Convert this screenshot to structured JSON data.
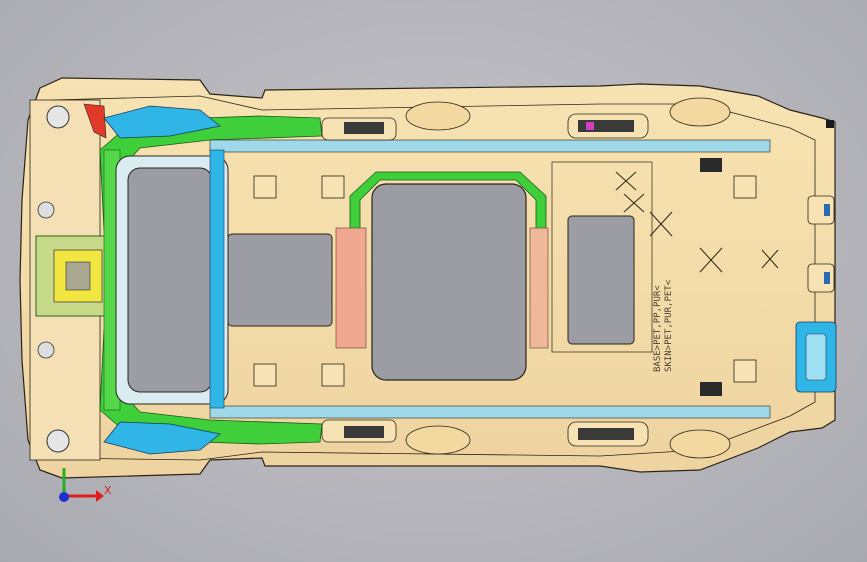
{
  "viewer": {
    "background_color": "#b6b6bc"
  },
  "model": {
    "colors": {
      "panel": "#f3dca8",
      "outline": "#2a2418",
      "green": "#3fcf3a",
      "blue": "#2fb6e6",
      "salmon": "#f0a890",
      "red": "#e23a2a",
      "yellow": "#f2e640",
      "dark": "#2a2a2a"
    },
    "markings": {
      "line1": "BASE>PET,PP,PUR<",
      "line2": "SKIN>PET,PUR,PET<"
    }
  },
  "triad": {
    "x_label": "X",
    "x_color": "#e02020",
    "y_color": "#20b020",
    "origin_color": "#2030d0"
  }
}
